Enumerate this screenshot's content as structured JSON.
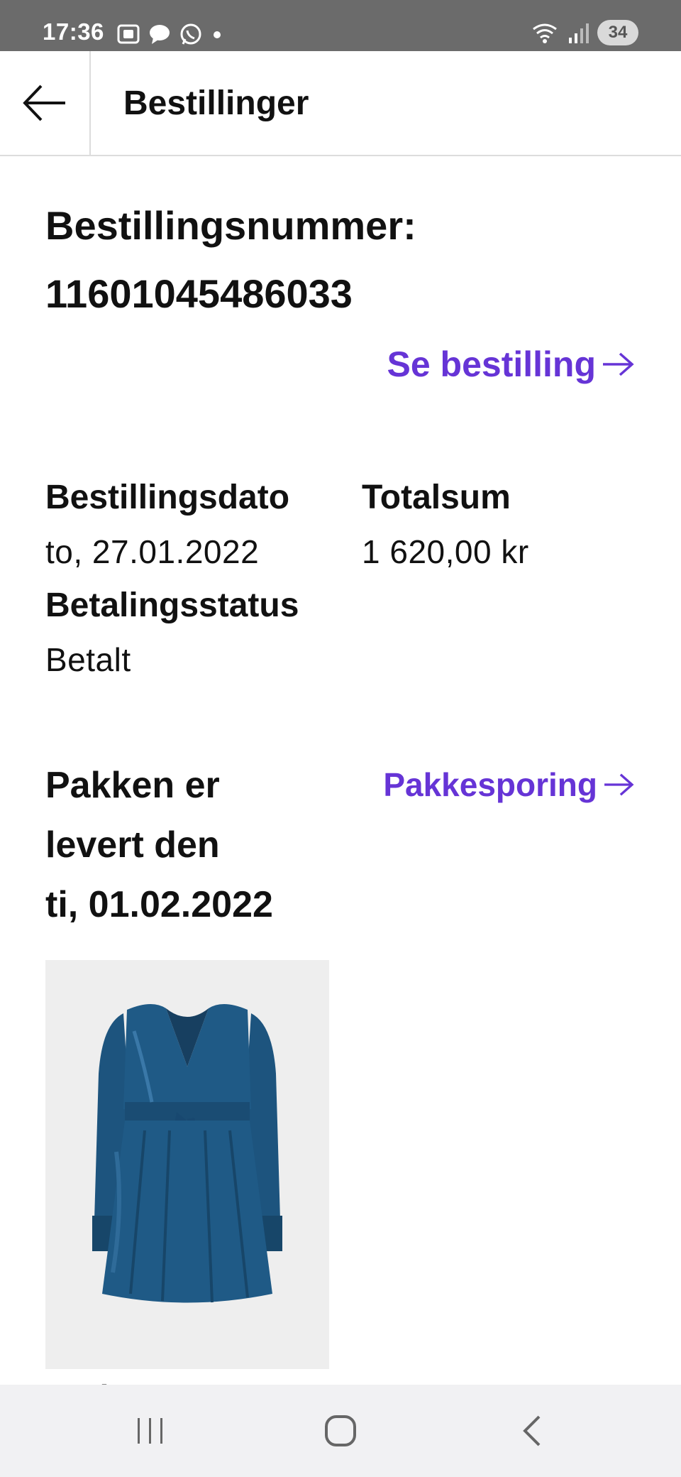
{
  "status_bar": {
    "time": "17:36",
    "battery": "34",
    "left_icons": [
      "screenshot-icon",
      "chat-bubble-icon",
      "whatsapp-icon",
      "dot-icon"
    ],
    "right_icons": [
      "wifi-icon",
      "signal-icon",
      "battery-icon"
    ]
  },
  "header": {
    "title": "Bestillinger",
    "back_icon": "arrow-left-icon"
  },
  "order": {
    "number_label": "Bestillingsnummer:",
    "number": "11601045486033",
    "see_order_link": "Se bestilling",
    "order_date_label": "Bestillingsdato",
    "order_date": "to, 27.01.2022",
    "total_label": "Totalsum",
    "total": "1 620,00 kr",
    "payment_status_label": "Betalingsstatus",
    "payment_status": "Betalt"
  },
  "delivery": {
    "line1": "Pakken er",
    "line2": "levert den",
    "line3": "ti, 01.02.2022",
    "tracking_link": "Pakkesporing"
  },
  "product": {
    "image": "blue-wrap-dress-image",
    "name_partial": "Springr"
  },
  "nav_bar": {
    "buttons": [
      "recent-apps-icon",
      "home-icon",
      "back-icon"
    ]
  },
  "colors": {
    "link": "#6634d6",
    "status_bar": "#6b6b6b",
    "nav_bar": "#f1f1f3",
    "dress": "#1f5a86"
  }
}
